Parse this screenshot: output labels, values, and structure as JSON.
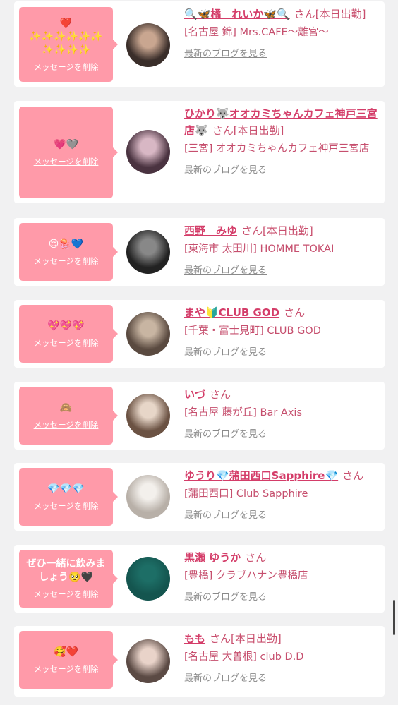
{
  "delete_label": "メッセージを削除",
  "blog_label": "最新のブログを見る",
  "san_label": "さん",
  "items": [
    {
      "message": "❤️\n✨✨✨✨✨✨\n✨✨✨✨",
      "name": "🔍🦋橘　れいか🦋🔍",
      "status": "[本日出勤]",
      "shop": "[名古屋 錦] Mrs.CAFE〜離宮〜",
      "avatar_colors": [
        "#3a2e2a",
        "#c9a690"
      ]
    },
    {
      "message": "💗🩶",
      "name": "ひかり🐺オオカミちゃんカフェ神戸三宮店🐺",
      "status": "[本日出勤]",
      "shop": "[三宮] オオカミちゃんカフェ神戸三宮店",
      "avatar_colors": [
        "#4a3340",
        "#d8b7c4"
      ]
    },
    {
      "message": "😌🪼💙",
      "name": "西野　みゆ",
      "status": "[本日出勤]",
      "shop": "[東海市 太田川] HOMME TOKAI",
      "avatar_colors": [
        "#222222",
        "#888888"
      ]
    },
    {
      "message": "💖💖💖",
      "name": "まや🔰CLUB GOD",
      "status": "",
      "shop": "[千葉・富士見町] CLUB GOD",
      "avatar_colors": [
        "#5a4a40",
        "#c8b5a2"
      ]
    },
    {
      "message": "🙈",
      "name": "いづ",
      "status": "",
      "shop": "[名古屋 藤が丘] Bar Axis",
      "avatar_colors": [
        "#6b5243",
        "#e7d6c8"
      ]
    },
    {
      "message": "💎💎💎",
      "name": "ゆうり💎蒲田西口Sapphire💎",
      "status": "",
      "shop": "[蒲田西口] Club Sapphire",
      "avatar_colors": [
        "#b8b0a8",
        "#f3f0ec"
      ]
    },
    {
      "message": "ぜひ一緒に飲みましょう🥺🖤",
      "name": "黒瀬 ゆうか",
      "status": "",
      "shop": "[豊橋] クラブハナン豊橋店",
      "avatar_colors": [
        "#14554f",
        "#1d6e66"
      ]
    },
    {
      "message": "🥰❤️",
      "name": "もも",
      "status": "[本日出勤]",
      "shop": "[名古屋 大曽根] club D.D",
      "avatar_colors": [
        "#5b4a44",
        "#e9d3c9"
      ]
    }
  ]
}
